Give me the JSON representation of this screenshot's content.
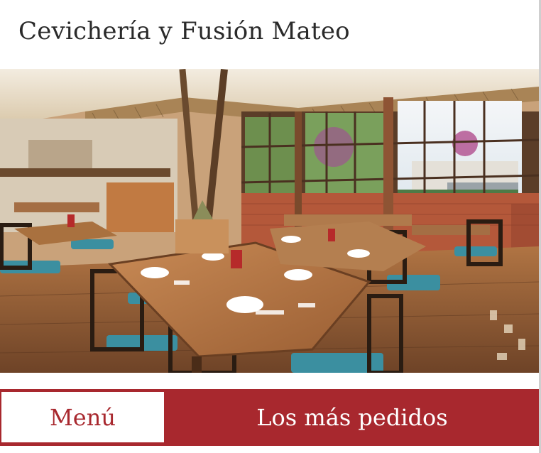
{
  "header": {
    "title": "Cevichería y Fusión Mateo"
  },
  "carousel": {
    "image_alt": "Restaurant dining room with wooden tables and teal cushioned chairs",
    "slides": [
      {
        "label": "slide-1",
        "active": false
      },
      {
        "label": "slide-2",
        "active": true
      },
      {
        "label": "slide-3",
        "active": false
      }
    ]
  },
  "tabs": {
    "menu_label": "Menú",
    "popular_label": "Los más pedidos"
  },
  "colors": {
    "accent": "#a8282e",
    "title_text": "#2a2a2a",
    "background": "#ffffff"
  }
}
